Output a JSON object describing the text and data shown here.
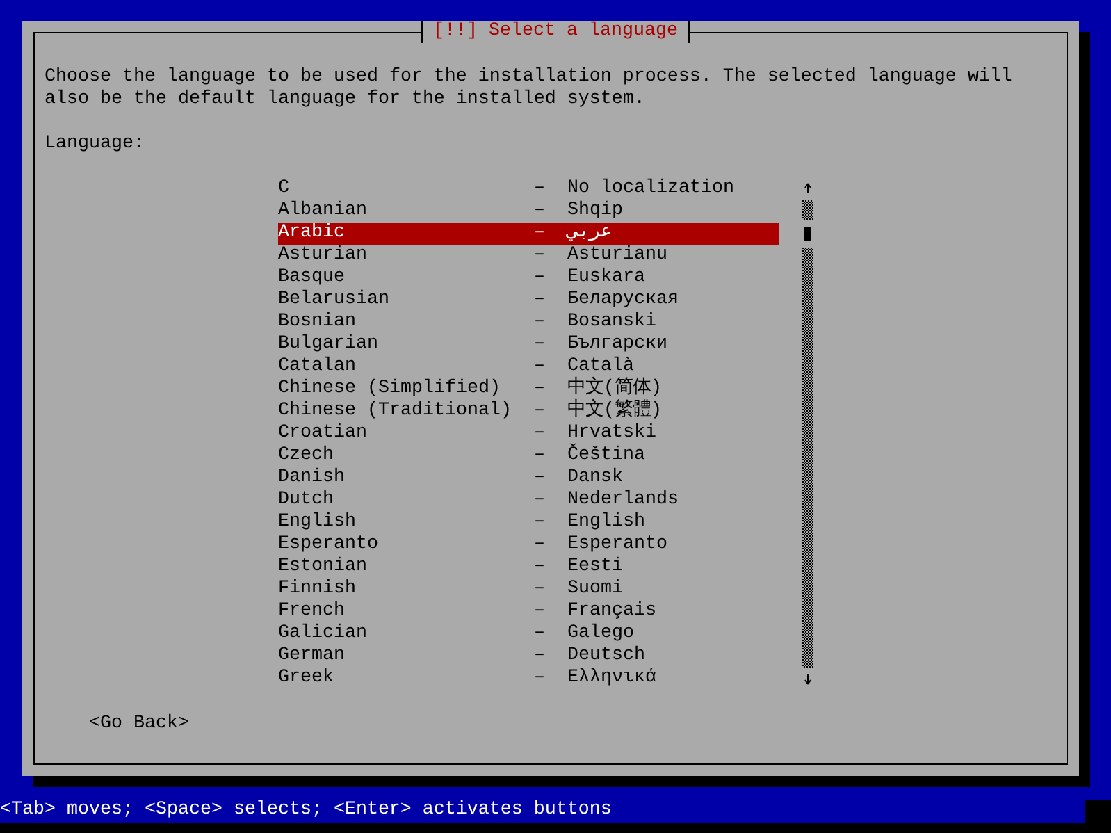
{
  "dialog": {
    "title": "[!!] Select a language",
    "intro": [
      "Choose the language to be used for the installation process. The selected language will",
      "also be the default language for the installed system."
    ],
    "list_label": "Language:",
    "languages": [
      {
        "name": "C",
        "dash": "–",
        "native": "No localization",
        "selected": false
      },
      {
        "name": "Albanian",
        "dash": "–",
        "native": "Shqip",
        "selected": false
      },
      {
        "name": "Arabic",
        "dash": "–",
        "native": "عربي",
        "selected": true
      },
      {
        "name": "Asturian",
        "dash": "–",
        "native": "Asturianu",
        "selected": false
      },
      {
        "name": "Basque",
        "dash": "–",
        "native": "Euskara",
        "selected": false
      },
      {
        "name": "Belarusian",
        "dash": "–",
        "native": "Беларуская",
        "selected": false
      },
      {
        "name": "Bosnian",
        "dash": "–",
        "native": "Bosanski",
        "selected": false
      },
      {
        "name": "Bulgarian",
        "dash": "–",
        "native": "Български",
        "selected": false
      },
      {
        "name": "Catalan",
        "dash": "–",
        "native": "Català",
        "selected": false
      },
      {
        "name": "Chinese (Simplified)",
        "dash": "–",
        "native": "中文(简体)",
        "selected": false
      },
      {
        "name": "Chinese (Traditional)",
        "dash": "–",
        "native": "中文(繁體)",
        "selected": false
      },
      {
        "name": "Croatian",
        "dash": "–",
        "native": "Hrvatski",
        "selected": false
      },
      {
        "name": "Czech",
        "dash": "–",
        "native": "Čeština",
        "selected": false
      },
      {
        "name": "Danish",
        "dash": "–",
        "native": "Dansk",
        "selected": false
      },
      {
        "name": "Dutch",
        "dash": "–",
        "native": "Nederlands",
        "selected": false
      },
      {
        "name": "English",
        "dash": "–",
        "native": "English",
        "selected": false
      },
      {
        "name": "Esperanto",
        "dash": "–",
        "native": "Esperanto",
        "selected": false
      },
      {
        "name": "Estonian",
        "dash": "–",
        "native": "Eesti",
        "selected": false
      },
      {
        "name": "Finnish",
        "dash": "–",
        "native": "Suomi",
        "selected": false
      },
      {
        "name": "French",
        "dash": "–",
        "native": "Français",
        "selected": false
      },
      {
        "name": "Galician",
        "dash": "–",
        "native": "Galego",
        "selected": false
      },
      {
        "name": "German",
        "dash": "–",
        "native": "Deutsch",
        "selected": false
      },
      {
        "name": "Greek",
        "dash": "–",
        "native": "Ελληνικά",
        "selected": false
      }
    ],
    "buttons": [
      "<Go Back>"
    ]
  },
  "status_bar": "<Tab> moves; <Space> selects; <Enter> activates buttons"
}
